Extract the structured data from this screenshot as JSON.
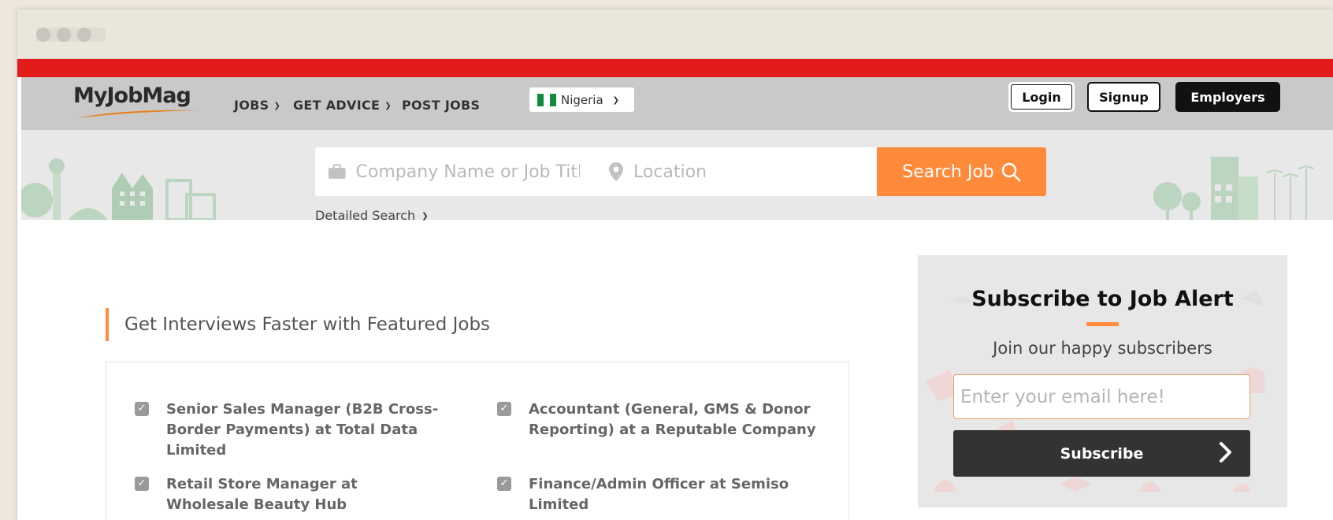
{
  "brand": {
    "logo_text": "MyJobMag",
    "accent": "#ff8a3a",
    "red": "#e31b1b"
  },
  "nav": {
    "items": [
      {
        "label": "JOBS",
        "dropdown": true
      },
      {
        "label": "GET ADVICE",
        "dropdown": true
      },
      {
        "label": "POST JOBS",
        "dropdown": false
      }
    ],
    "country": "Nigeria",
    "login": "Login",
    "signup": "Signup",
    "employers": "Employers"
  },
  "search": {
    "job_placeholder": "Company Name or Job Title",
    "location_placeholder": "Location",
    "button": "Search Job",
    "detailed": "Detailed Search"
  },
  "featured": {
    "heading": "Get Interviews Faster with Featured Jobs",
    "jobs": [
      "Senior Sales Manager (B2B Cross-Border Payments) at Total Data Limited",
      "Accountant (General, GMS & Donor Reporting) at a Reputable Company",
      "Retail Store Manager at Wholesale Beauty Hub",
      "Finance/Admin Officer at Semiso Limited"
    ]
  },
  "subscribe": {
    "title": "Subscribe to Job Alert",
    "subtitle": "Join our happy subscribers",
    "email_placeholder": "Enter your email here!",
    "button": "Subscribe"
  }
}
